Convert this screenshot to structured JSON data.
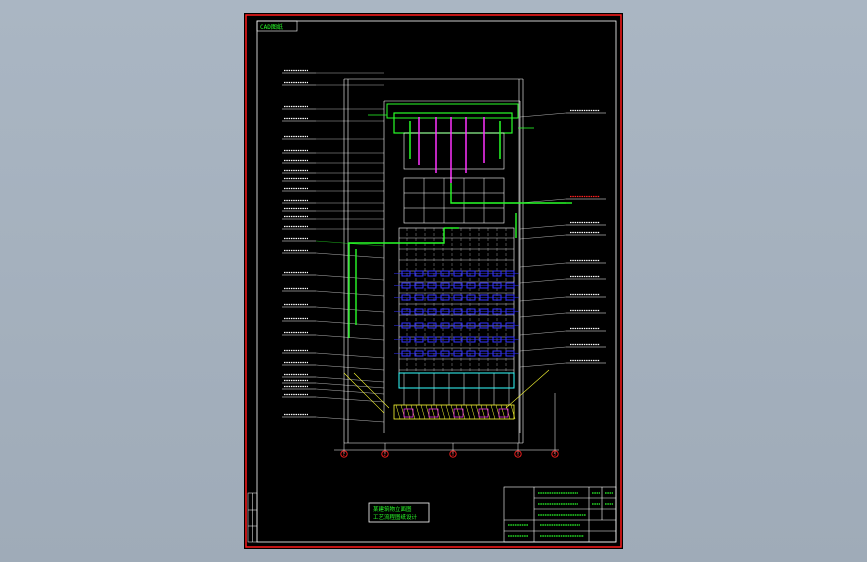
{
  "viewport": {
    "background": "#a9b5c2"
  },
  "sheet": {
    "background": "#000000",
    "frame_color": "#ff1a1a",
    "line_color": "#ffffff"
  },
  "corner_tag": "CAD图纸",
  "drawing_title": {
    "line1": "某建筑物立面图",
    "line2": "工艺流程图纸设计"
  },
  "grid_axes": [
    "1",
    "2",
    "3",
    "4",
    "5"
  ],
  "colors": {
    "accent_green": "#29ff29",
    "magenta": "#ff33ff",
    "blue": "#3333ff",
    "yellow": "#ffff33",
    "cyan": "#33ffff",
    "red": "#ff2020"
  }
}
